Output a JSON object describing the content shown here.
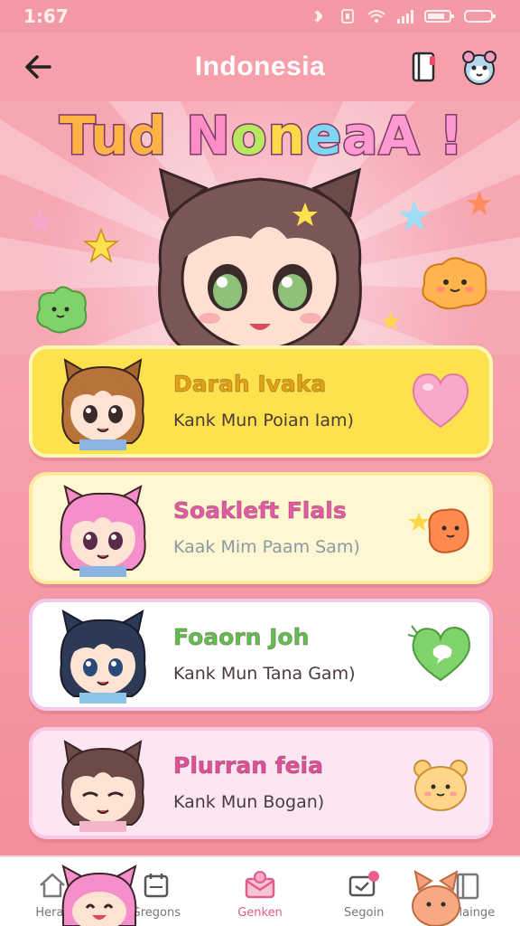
{
  "status_bar": {
    "time": "1:67",
    "icons": [
      "bluetooth-icon",
      "nfc-icon",
      "wifi-icon",
      "signal-icon",
      "battery-icon"
    ]
  },
  "app_bar": {
    "title": "Indonesia",
    "back_icon": "back-arrow-icon",
    "book_icon": "book-icon",
    "mascot_icon": "mascot-avatar-icon"
  },
  "hero": {
    "title_parts": [
      "Tud ",
      "N",
      "o",
      "n",
      "e",
      "aA !"
    ]
  },
  "cards": [
    {
      "name": "Darah Ivaka",
      "subtitle": "Kank Mun Poian Iam)",
      "side_icon": "heart-icon",
      "bg": "#fde24d"
    },
    {
      "name": "Soakleft Flals",
      "subtitle": "Kaak Mim Paam Sam)",
      "side_icon": "orange-blob-icon",
      "bg": "#fef7d2"
    },
    {
      "name": "Foaorn Joh",
      "subtitle": "Kank Mun Tana Gam)",
      "side_icon": "green-speech-heart-icon",
      "bg": "#ffffff"
    },
    {
      "name": "Plurran feia",
      "subtitle": "Kank Mun Bogan)",
      "side_icon": "bear-icon",
      "bg": "#fde6f3"
    }
  ],
  "bottom_nav": {
    "items": [
      {
        "label": "Herar",
        "icon": "home-icon",
        "active": false
      },
      {
        "label": "Gregons",
        "icon": "calendar-icon",
        "active": false
      },
      {
        "label": "Genken",
        "icon": "envelope-icon",
        "active": true
      },
      {
        "label": "Segoin",
        "icon": "chat-icon",
        "active": false
      },
      {
        "label": "Kailainge",
        "icon": "book-icon",
        "active": false
      }
    ]
  },
  "colors": {
    "primary_pink": "#f6a0ab",
    "accent_pink": "#e25b8a",
    "yellow": "#fde24d"
  }
}
